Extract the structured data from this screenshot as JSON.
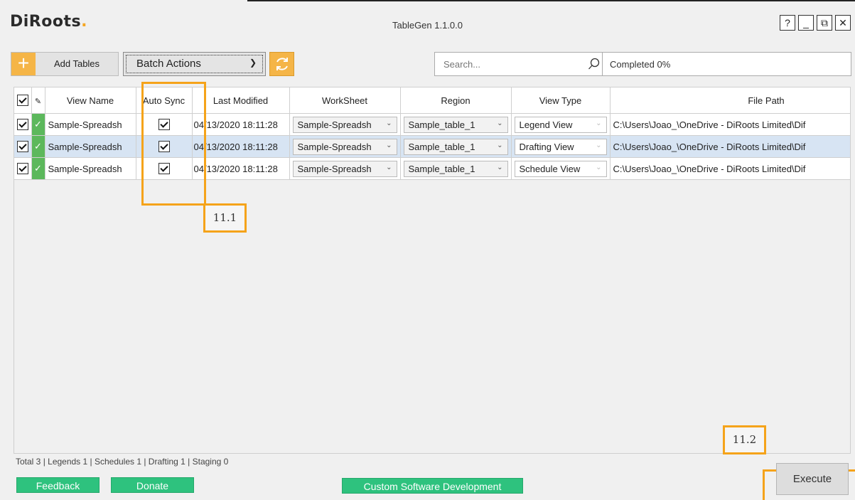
{
  "app": {
    "logo_text": "DiRoots",
    "logo_dot": ".",
    "title": "TableGen 1.1.0.0"
  },
  "window_controls": {
    "help": "?",
    "minimize": "_",
    "restore": "⧉",
    "close": "✕"
  },
  "toolbar": {
    "add_tables_label": "Add Tables",
    "batch_actions_label": "Batch Actions",
    "search_placeholder": "Search...",
    "progress_text": "Completed 0%"
  },
  "table": {
    "headers": [
      "View Name",
      "Auto Sync",
      "Last Modified",
      "WorkSheet",
      "Region",
      "View Type",
      "File Path"
    ],
    "rows": [
      {
        "view_name": "Sample-Spreadsh",
        "last_modified": "04/13/2020 18:11:28",
        "worksheet": "Sample-Spreadsh",
        "region": "Sample_table_1",
        "view_type": "Legend View",
        "file_path": "C:\\Users\\Joao_\\OneDrive - DiRoots Limited\\Dif"
      },
      {
        "view_name": "Sample-Spreadsh",
        "last_modified": "04/13/2020 18:11:28",
        "worksheet": "Sample-Spreadsh",
        "region": "Sample_table_1",
        "view_type": "Drafting View",
        "file_path": "C:\\Users\\Joao_\\OneDrive - DiRoots Limited\\Dif"
      },
      {
        "view_name": "Sample-Spreadsh",
        "last_modified": "04/13/2020 18:11:28",
        "worksheet": "Sample-Spreadsh",
        "region": "Sample_table_1",
        "view_type": "Schedule View",
        "file_path": "C:\\Users\\Joao_\\OneDrive - DiRoots Limited\\Dif"
      }
    ]
  },
  "callouts": {
    "auto_sync": "11.1",
    "execute": "11.2"
  },
  "footer": {
    "summary": "Total 3 | Legends 1 | Schedules 1 | Drafting 1 | Staging 0",
    "feedback": "Feedback",
    "donate": "Donate",
    "custom_dev": "Custom Software Development",
    "execute": "Execute"
  },
  "colors": {
    "accent_orange": "#f5b547",
    "highlight_orange": "#f5a31a",
    "success_green": "#5cb85c",
    "button_green": "#2ec27e",
    "selected_row": "#d7e4f3"
  }
}
